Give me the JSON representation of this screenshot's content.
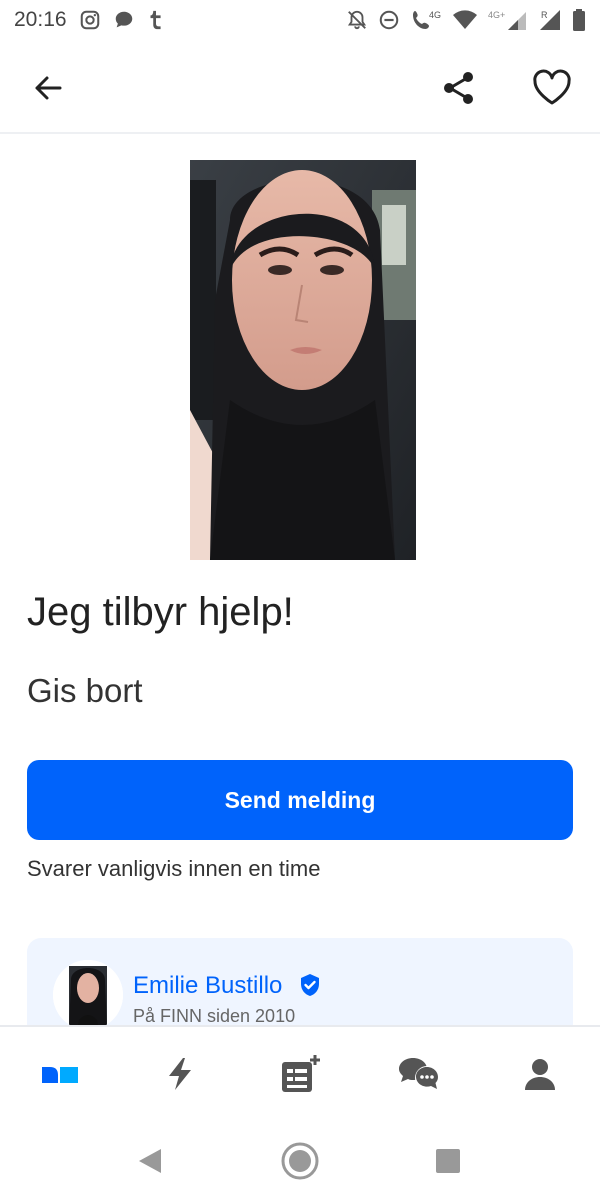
{
  "status_bar": {
    "time": "20:16",
    "network_label": "4G",
    "network_label2": "4G+",
    "roaming_label": "R",
    "icons": [
      "instagram-icon",
      "message-icon",
      "tumblr-icon",
      "mute-icon",
      "dnd-icon",
      "volte-call-icon",
      "wifi-icon",
      "signal-icon",
      "signal-roaming-icon",
      "battery-icon"
    ]
  },
  "app_bar": {
    "icons": [
      "back-arrow-icon",
      "share-icon",
      "heart-icon"
    ]
  },
  "ad": {
    "title": "Jeg tilbyr hjelp!",
    "price": "Gis bort",
    "send_button": "Send melding",
    "reply_note": "Svarer vanligvis innen en time"
  },
  "seller": {
    "name": "Emilie Bustillo",
    "since": "På FINN siden 2010"
  },
  "bottom_nav": {
    "items": [
      "home-icon",
      "flash-icon",
      "new-ad-icon",
      "messages-icon",
      "profile-icon"
    ]
  },
  "colors": {
    "accent": "#0063fb",
    "card_bg": "#eff5ff",
    "icon": "#555555"
  }
}
